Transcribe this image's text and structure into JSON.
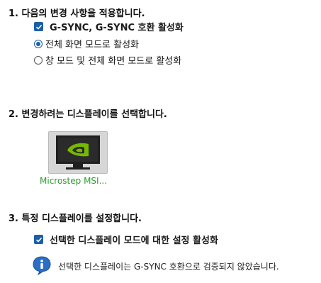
{
  "section1": {
    "heading": "1. 다음의 변경 사항을 적용합니다.",
    "checkbox_label": "G-SYNC, G-SYNC 호환 활성화",
    "radio_options": [
      {
        "label": "전체 화면 모드로 활성화",
        "selected": true
      },
      {
        "label": "창 모드 및 전체 화면 모드로 활성화",
        "selected": false
      }
    ]
  },
  "section2": {
    "heading": "2. 변경하려는 디스플레이를 선택합니다.",
    "display_label": "Microstep MSI..."
  },
  "section3": {
    "heading": "3. 특정 디스플레이를 설정합니다.",
    "checkbox_label": "선택한 디스플레이 모드에 대한 설정 활성화",
    "info_text": "선택한 디스플레이는 G-SYNC 호환으로 검증되지 않았습니다."
  },
  "colors": {
    "accent": "#1b5fa8",
    "display_label": "#2e9b2e",
    "nvidia_green": "#76b900"
  },
  "icons": [
    "checkmark-icon",
    "monitor-icon",
    "nvidia-logo-icon",
    "info-icon"
  ]
}
